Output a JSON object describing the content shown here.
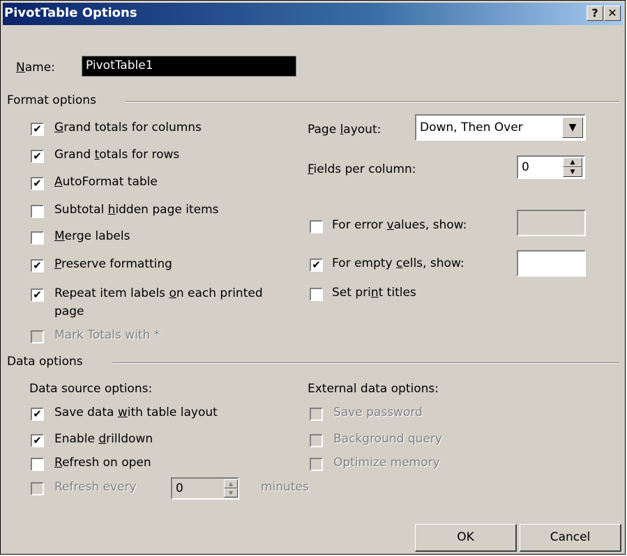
{
  "window": {
    "title": "PivotTable Options",
    "help_label": "?",
    "close_label": "✕"
  },
  "name_field": {
    "label_ul": "N",
    "label_rest": "ame:",
    "value": "PivotTable1"
  },
  "format_options": {
    "group_label": "Format options",
    "items": [
      {
        "pre": "",
        "ul": "G",
        "post": "rand totals for columns",
        "checked": true,
        "enabled": true
      },
      {
        "pre": "Grand ",
        "ul": "t",
        "post": "otals for rows",
        "checked": true,
        "enabled": true
      },
      {
        "pre": "",
        "ul": "A",
        "post": "utoFormat table",
        "checked": true,
        "enabled": true
      },
      {
        "pre": "Subtotal ",
        "ul": "h",
        "post": "idden page items",
        "checked": false,
        "enabled": true
      },
      {
        "pre": "",
        "ul": "M",
        "post": "erge labels",
        "checked": false,
        "enabled": true
      },
      {
        "pre": "",
        "ul": "P",
        "post": "reserve formatting",
        "checked": true,
        "enabled": true
      }
    ],
    "repeat_labels": {
      "line1_pre": "Repeat item labels ",
      "line1_ul": "o",
      "line1_post": "n each printed",
      "line2": "page",
      "checked": true
    },
    "mark_totals": {
      "label": "Mark Totals with *",
      "checked": false,
      "enabled": false
    },
    "page_layout": {
      "label_pre": "Page ",
      "label_ul": "l",
      "label_post": "ayout:",
      "value": "Down, Then Over"
    },
    "fields_per_column": {
      "label_ul": "F",
      "label_post": "ields per column:",
      "value": "0"
    },
    "error_values": {
      "pre": "For error ",
      "ul": "v",
      "post": "alues, show:",
      "checked": false,
      "value": ""
    },
    "empty_cells": {
      "pre": "For empty ",
      "ul": "c",
      "post": "ells, show:",
      "checked": true,
      "value": ""
    },
    "print_titles": {
      "pre": "Set pri",
      "ul": "n",
      "post": "t titles",
      "checked": false
    }
  },
  "data_options": {
    "group_label": "Data options",
    "source_heading": "Data source options:",
    "source_items": [
      {
        "pre": "Save data ",
        "ul": "w",
        "post": "ith table layout",
        "checked": true,
        "enabled": true
      },
      {
        "pre": "Enable ",
        "ul": "d",
        "post": "rilldown",
        "checked": true,
        "enabled": true
      },
      {
        "pre": "",
        "ul": "R",
        "post": "efresh on open",
        "checked": false,
        "enabled": true
      }
    ],
    "refresh_every": {
      "label": "Refresh every",
      "value": "0",
      "unit": "minutes",
      "checked": false,
      "enabled": false
    },
    "external_heading": "External data options:",
    "external_items": [
      {
        "label": "Save password",
        "checked": false,
        "enabled": false
      },
      {
        "label": "Background query",
        "checked": false,
        "enabled": false
      },
      {
        "label": "Optimize memory",
        "checked": false,
        "enabled": false
      }
    ]
  },
  "buttons": {
    "ok": "OK",
    "cancel": "Cancel"
  },
  "glyphs": {
    "check": "✔",
    "down_arrow": "▼",
    "up_arrow": "▲"
  },
  "colors": {
    "dialog_bg": "#d4d0c8",
    "title_start": "#0a246a",
    "title_end": "#a6caf0"
  }
}
